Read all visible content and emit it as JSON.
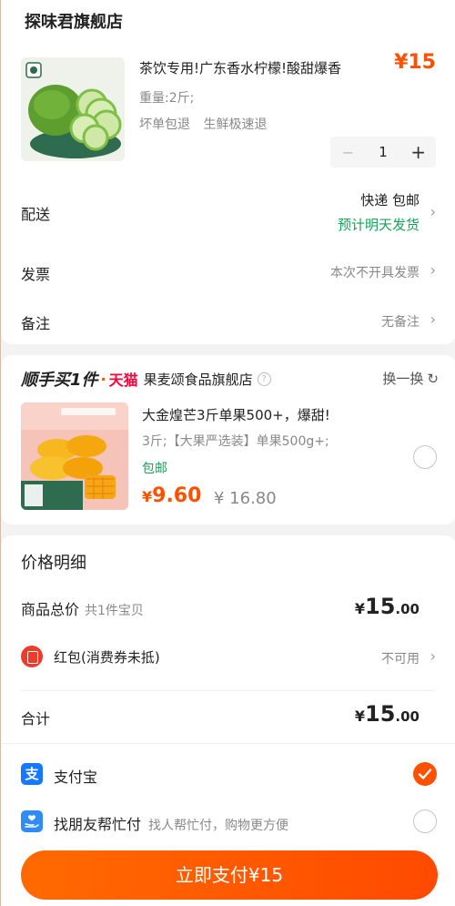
{
  "store": {
    "name": "探味君旗舰店",
    "product": {
      "title": "茶饮专用!广东香水柠檬!酸甜爆香",
      "price": "¥15",
      "weight": "重量:2斤;",
      "tags": [
        "坏单包退",
        "生鲜极速退"
      ],
      "qty": "1",
      "minus": "−",
      "plus": "+"
    },
    "delivery": {
      "label": "配送",
      "method": "快递 包邮",
      "note": "预计明天发货"
    },
    "invoice": {
      "label": "发票",
      "value": "本次不开具发票"
    },
    "remark": {
      "label": "备注",
      "value": "无备注"
    }
  },
  "bundle": {
    "brand": "顺手买1件",
    "dot": "·",
    "platform": "天猫",
    "store": "果麦颂食品旗舰店",
    "help": "?",
    "swap": "换一换",
    "product": {
      "title": "大金煌芒3斤单果500+，爆甜!",
      "spec": "3斤;【大果严选装】单果500g+;",
      "shipping": "包邮",
      "price_cur": "¥",
      "price": "9.60",
      "old_price": "¥ 16.80"
    }
  },
  "price_detail": {
    "title": "价格明细",
    "goods_total": {
      "label": "商品总价",
      "note": "共1件宝贝",
      "cur": "¥",
      "int": "15",
      "dec": ".00"
    },
    "hongbao": {
      "label": "红包(消费券未抵)",
      "value": "不可用"
    },
    "total": {
      "label": "合计",
      "cur": "¥",
      "int": "15",
      "dec": ".00"
    }
  },
  "payment": {
    "alipay": {
      "label": "支付宝",
      "icon_text": "支",
      "selected": true
    },
    "friend": {
      "label": "找朋友帮忙付",
      "note": "找人帮忙付，购物更方便",
      "selected": false
    },
    "button": "立即支付¥15"
  },
  "colors": {
    "accent": "#ff5000",
    "green": "#16a35a",
    "alipay_blue": "#1677ff",
    "tmall_red": "#ff0036"
  },
  "icons": [
    "chevron-right-icon",
    "help-circle-icon",
    "refresh-icon",
    "red-packet-icon",
    "alipay-icon",
    "friend-pay-icon",
    "checkmark-icon"
  ]
}
